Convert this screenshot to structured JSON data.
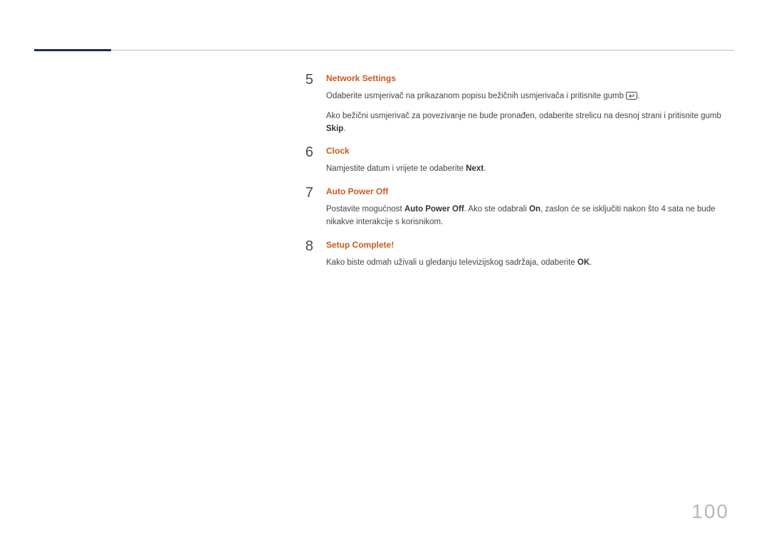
{
  "page_number": "100",
  "steps": [
    {
      "num": "5",
      "heading": "Network Settings",
      "paragraphs": [
        {
          "pre": "Odaberite usmjerivač na prikazanom popisu bežičnih usmjerivača i pritisnite gumb ",
          "icon": "enter",
          "post": "."
        },
        {
          "pre": "Ako bežični usmjerivač za povezivanje ne bude pronađen, odaberite strelicu na desnoj strani i pritisnite gumb ",
          "bold": "Skip",
          "post": "."
        }
      ]
    },
    {
      "num": "6",
      "heading": "Clock",
      "paragraphs": [
        {
          "pre": "Namjestite datum i vrijete te odaberite ",
          "bold": "Next",
          "post": "."
        }
      ]
    },
    {
      "num": "7",
      "heading": "Auto Power Off",
      "paragraphs": [
        {
          "pre": "Postavite mogućnost ",
          "bold": "Auto Power Off",
          "mid": ". Ako ste odabrali ",
          "bold2": "On",
          "post": ", zaslon će se isključiti nakon što 4 sata ne bude nikakve interakcije s korisnikom."
        }
      ]
    },
    {
      "num": "8",
      "heading": "Setup Complete!",
      "paragraphs": [
        {
          "pre": "Kako biste odmah uživali u gledanju televizijskog sadržaja, odaberite ",
          "bold": "OK",
          "post": "."
        }
      ]
    }
  ]
}
